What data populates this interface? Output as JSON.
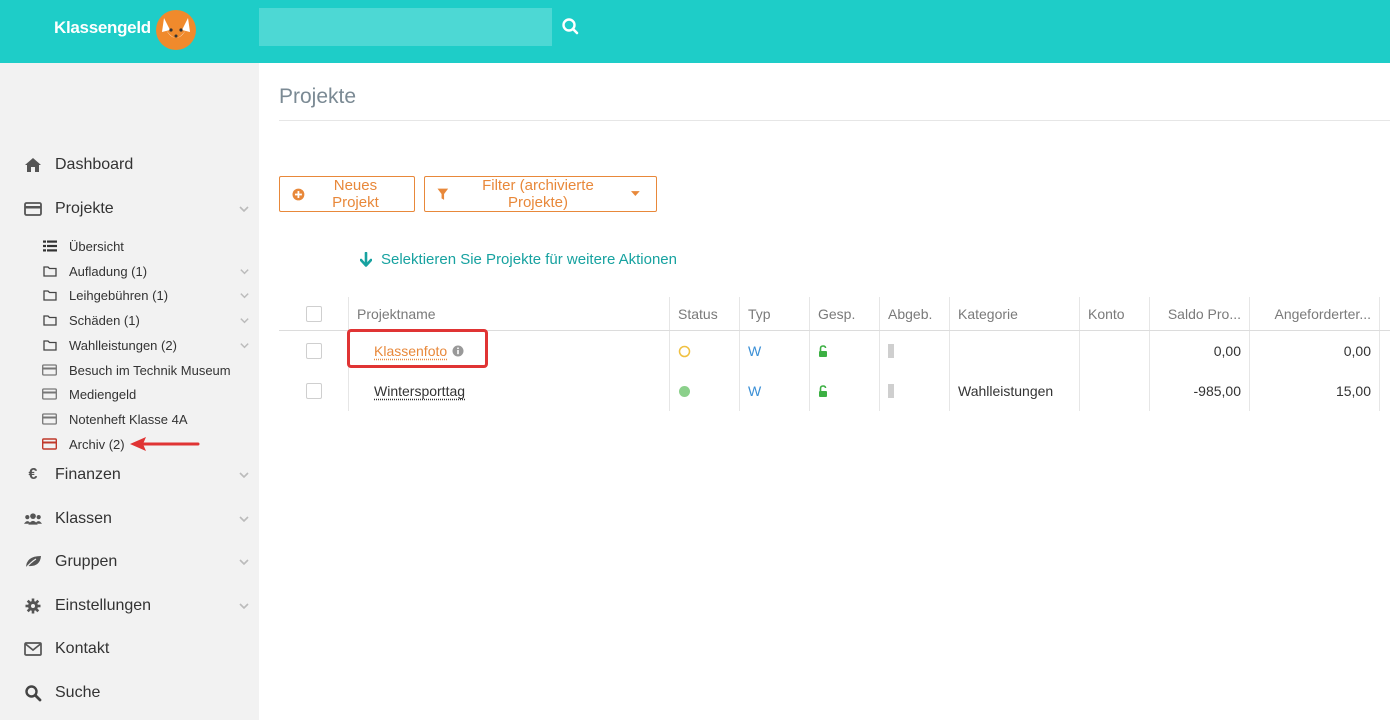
{
  "header": {
    "brand": "Klassengeld",
    "search": {
      "value": "",
      "placeholder": ""
    }
  },
  "sidebar": {
    "items": [
      {
        "label": "Dashboard",
        "icon": "home-icon"
      },
      {
        "label": "Projekte",
        "icon": "card-icon",
        "expanded": true
      },
      {
        "label": "Finanzen",
        "icon": "euro-icon"
      },
      {
        "label": "Klassen",
        "icon": "users-icon"
      },
      {
        "label": "Gruppen",
        "icon": "leaf-icon"
      },
      {
        "label": "Einstellungen",
        "icon": "gear-icon"
      },
      {
        "label": "Kontakt",
        "icon": "envelope-icon"
      },
      {
        "label": "Suche",
        "icon": "search-icon"
      }
    ],
    "projekte_sub": [
      {
        "label": "Übersicht",
        "icon": "list-icon"
      },
      {
        "label": "Aufladung (1)",
        "icon": "folder-icon"
      },
      {
        "label": "Leihgebühren (1)",
        "icon": "folder-icon"
      },
      {
        "label": "Schäden (1)",
        "icon": "folder-icon"
      },
      {
        "label": "Wahlleistungen (2)",
        "icon": "folder-icon"
      },
      {
        "label": "Besuch im Technik Museum",
        "icon": "card-icon"
      },
      {
        "label": "Mediengeld",
        "icon": "card-icon"
      },
      {
        "label": "Notenheft Klasse 4A",
        "icon": "card-icon"
      },
      {
        "label": "Archiv (2)",
        "icon": "archive-card-icon"
      }
    ]
  },
  "main": {
    "title": "Projekte",
    "buttons": {
      "new_project": "Neues Projekt",
      "filter": "Filter (archivierte Projekte)"
    },
    "select_hint": "Selektieren Sie Projekte für weitere Aktionen",
    "table": {
      "columns": [
        "Projektname",
        "Status",
        "Typ",
        "Gesp.",
        "Abgeb.",
        "Kategorie",
        "Konto",
        "Saldo Pro...",
        "Angeforderter..."
      ],
      "rows": [
        {
          "name": "Klassenfoto",
          "status": "open",
          "typ": "W",
          "kategorie": "",
          "konto": "",
          "saldo": "0,00",
          "angefordert": "0,00"
        },
        {
          "name": "Wintersporttag",
          "status": "active",
          "typ": "W",
          "kategorie": "Wahlleistungen",
          "konto": "",
          "saldo": "-985,00",
          "angefordert": "15,00"
        }
      ]
    }
  },
  "colors": {
    "header": "#1ecdc8",
    "accent": "#e8883a",
    "teal_text": "#17a2a0",
    "highlight": "#e03434",
    "status_active": "#8bd08b",
    "status_open": "#f0c040",
    "lock_green": "#3cb043"
  }
}
